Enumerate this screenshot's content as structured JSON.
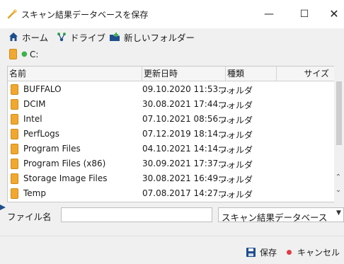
{
  "window": {
    "title": "スキャン結果データベースを保存",
    "minimize": "—",
    "maximize": "☐",
    "close": "✕"
  },
  "toolbar": {
    "home": "ホーム",
    "drive": "ドライブ",
    "new_folder": "新しいフォルダー"
  },
  "path": {
    "current": "C:"
  },
  "columns": {
    "name": "名前",
    "date": "更新日時",
    "type": "種類",
    "size": "サイズ"
  },
  "files": [
    {
      "name": "BUFFALO",
      "date": "09.10.2020 11:53:...",
      "type": "フォルダ"
    },
    {
      "name": "DCIM",
      "date": "30.08.2021 17:44:...",
      "type": "フォルダ"
    },
    {
      "name": "Intel",
      "date": "07.10.2021 08:56:...",
      "type": "フォルダ"
    },
    {
      "name": "PerfLogs",
      "date": "07.12.2019 18:14:...",
      "type": "フォルダ"
    },
    {
      "name": "Program Files",
      "date": "04.10.2021 14:14:...",
      "type": "フォルダ"
    },
    {
      "name": "Program Files (x86)",
      "date": "30.09.2021 17:37:...",
      "type": "フォルダ"
    },
    {
      "name": "Storage Image Files",
      "date": "30.08.2021 16:49:...",
      "type": "フォルダ"
    },
    {
      "name": "Temp",
      "date": "07.08.2017 14:27:...",
      "type": "フォルダ"
    }
  ],
  "scrollbar": {
    "up": "⌃",
    "down": "⌄"
  },
  "filename": {
    "label": "ファイル名",
    "value": ""
  },
  "filetype": {
    "selected": "スキャン結果データベース",
    "arrow": "▼"
  },
  "buttons": {
    "save": "保存",
    "cancel": "キャンセル"
  },
  "colors": {
    "folder": "#f0a830",
    "accent_blue": "#1f4e8c",
    "green_dot": "#3bb24b",
    "red_dot": "#e13b46"
  }
}
